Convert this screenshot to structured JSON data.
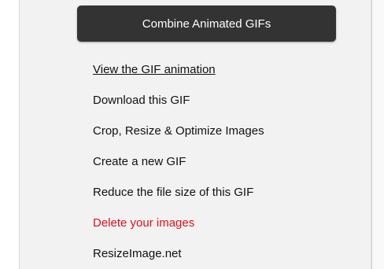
{
  "actions": {
    "combine_button_label": "Combine Animated GIFs",
    "links": [
      {
        "label": "View the GIF animation",
        "underlined": true
      },
      {
        "label": "Download this GIF"
      },
      {
        "label": "Crop, Resize & Optimize Images"
      },
      {
        "label": "Create a new GIF"
      },
      {
        "label": "Reduce the file size of this GIF"
      },
      {
        "label": "Delete your images",
        "color": "#e0101b"
      },
      {
        "label": "ResizeImage.net"
      }
    ]
  },
  "colors": {
    "button_bg": "#333333",
    "danger_text": "#e0101b",
    "link_text": "#111111"
  }
}
